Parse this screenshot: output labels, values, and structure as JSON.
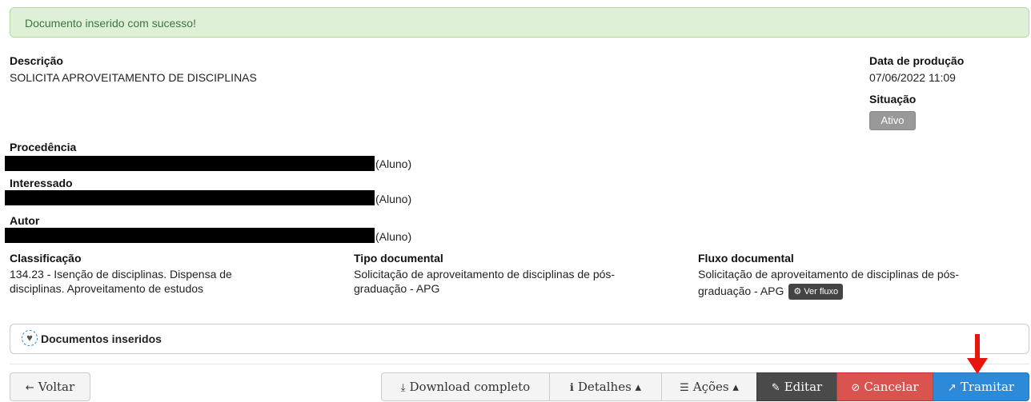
{
  "alert": {
    "message": "Documento inserido com sucesso!"
  },
  "descricao": {
    "label": "Descrição",
    "value": "SOLICITA APROVEITAMENTO DE DISCIPLINAS"
  },
  "data_producao": {
    "label": "Data de produção",
    "value": "07/06/2022 11:09"
  },
  "situacao": {
    "label": "Situação",
    "value": "Ativo"
  },
  "procedencia": {
    "label": "Procedência",
    "suffix": "(Aluno)"
  },
  "interessado": {
    "label": "Interessado",
    "suffix": "(Aluno)"
  },
  "autor": {
    "label": "Autor",
    "suffix": "(Aluno)"
  },
  "classificacao": {
    "label": "Classificação",
    "line1": "134.23 - Isenção de disciplinas. Dispensa de",
    "line2": "disciplinas. Aproveitamento de estudos"
  },
  "tipo_documental": {
    "label": "Tipo documental",
    "line1": "Solicitação de aproveitamento de disciplinas de pós-",
    "line2": "graduação - APG"
  },
  "fluxo_documental": {
    "label": "Fluxo documental",
    "line1": "Solicitação de aproveitamento de disciplinas de pós-",
    "line2": "graduação - APG",
    "button": "Ver fluxo"
  },
  "panel": {
    "title": "Documentos inseridos",
    "icon": "heart-cog-icon"
  },
  "toolbar": {
    "voltar": "Voltar",
    "download": "Download completo",
    "detalhes": "Detalhes",
    "acoes": "Ações",
    "editar": "Editar",
    "cancelar": "Cancelar",
    "tramitar": "Tramitar"
  },
  "colors": {
    "alert_bg": "#dff0d8",
    "alert_text": "#3c763d",
    "editar_bg": "#4a4a4a",
    "cancelar_bg": "#d9534f",
    "tramitar_bg": "#2d8ad8",
    "arrow": "#e8150c",
    "badge_bg": "#999999"
  }
}
